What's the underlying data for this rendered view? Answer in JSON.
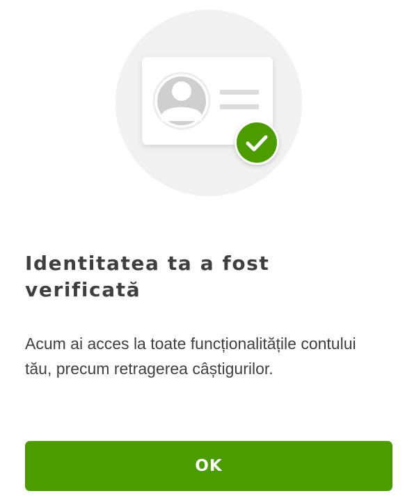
{
  "illustration": {
    "icon": "id-card-verified-icon",
    "background_color": "#f1f1f1",
    "check_color": "#4c9b00"
  },
  "dialog": {
    "title": "Identitatea ta a fost verificată",
    "message": "Acum ai acces la toate funcționalitățile contului tău, precum retragerea câștigurilor.",
    "ok_label": "OK"
  },
  "colors": {
    "accent": "#4c9b00",
    "text": "#3f3f3f"
  }
}
